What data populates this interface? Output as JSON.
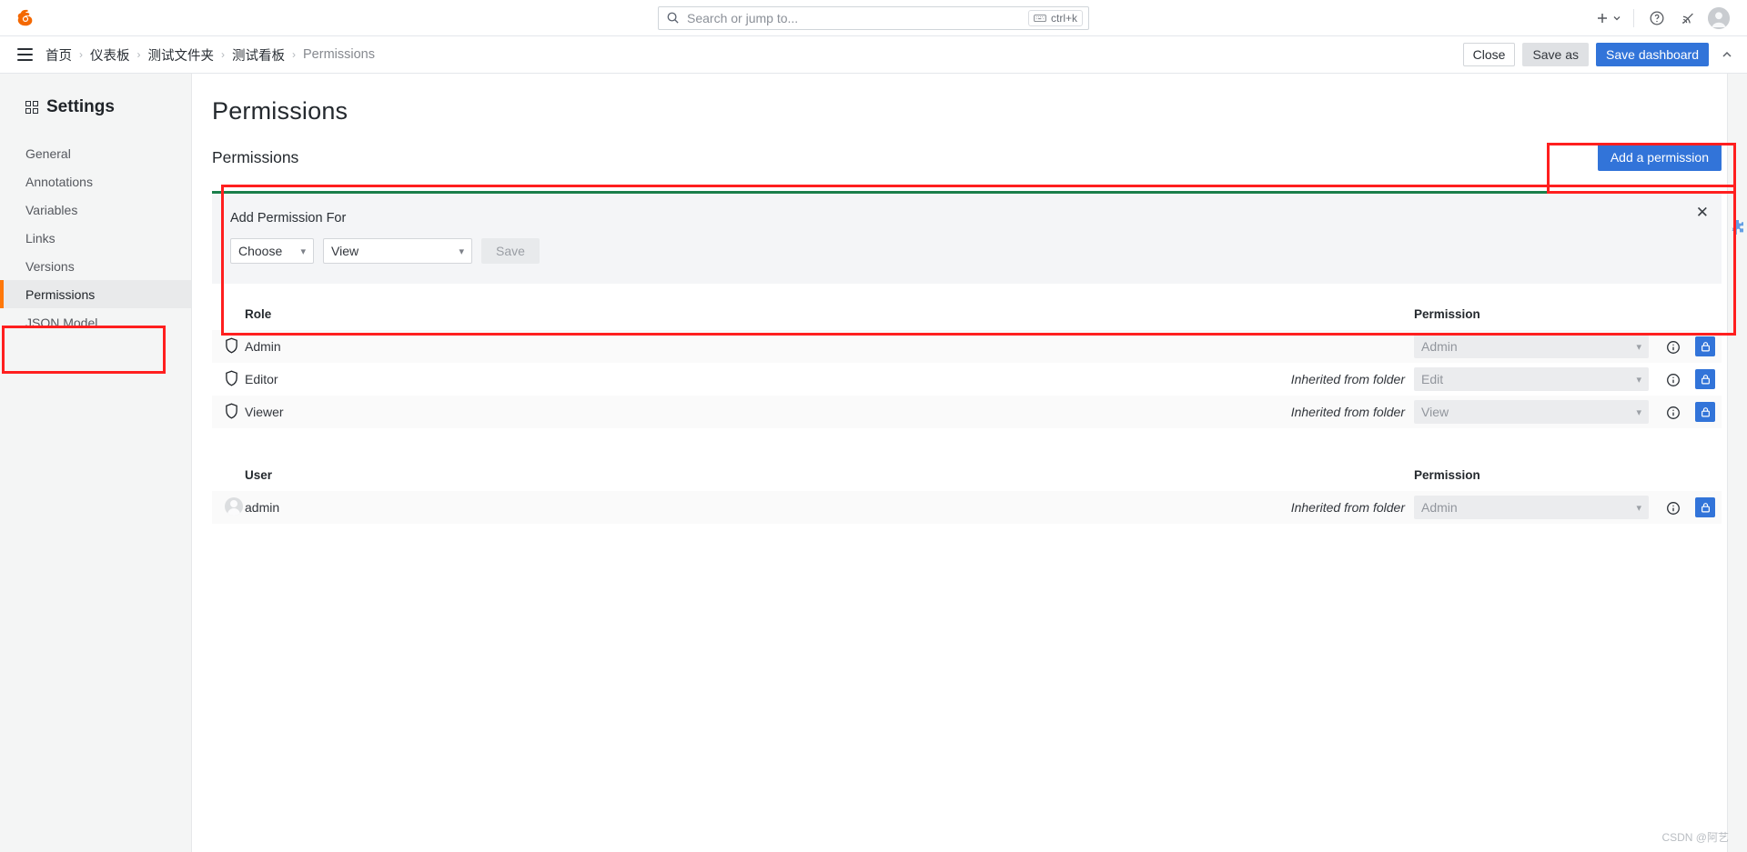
{
  "topbar": {
    "logo_icon": "grafana-logo-icon",
    "search": {
      "placeholder": "Search or jump to...",
      "icon": "search-icon",
      "shortcut": "ctrl+k",
      "shortcut_icon": "keyboard-icon"
    },
    "actions": {
      "plus_icon": "plus-icon",
      "plus_chevron_icon": "chevron-down-icon",
      "help_icon": "help-circle-icon",
      "news_icon": "rss-feed-icon",
      "avatar_icon": "user-avatar-icon"
    }
  },
  "navbar": {
    "menu_icon": "hamburger-menu-icon",
    "breadcrumbs": [
      {
        "label": "首页"
      },
      {
        "label": "仪表板"
      },
      {
        "label": "测试文件夹"
      },
      {
        "label": "测试看板"
      },
      {
        "label": "Permissions"
      }
    ],
    "separator": "›",
    "close_label": "Close",
    "save_as_label": "Save as",
    "save_dashboard_label": "Save dashboard",
    "collapse_icon": "chevron-up-icon"
  },
  "sidebar": {
    "title": "Settings",
    "title_icon": "grid-apps-icon",
    "items": [
      {
        "label": "General",
        "active": false
      },
      {
        "label": "Annotations",
        "active": false
      },
      {
        "label": "Variables",
        "active": false
      },
      {
        "label": "Links",
        "active": false
      },
      {
        "label": "Versions",
        "active": false
      },
      {
        "label": "Permissions",
        "active": true
      },
      {
        "label": "JSON Model",
        "active": false
      }
    ]
  },
  "main": {
    "page_title": "Permissions",
    "section_title": "Permissions",
    "add_permission_button": "Add a permission",
    "add_card": {
      "title": "Add Permission For",
      "close_icon": "close-icon",
      "target_select": {
        "value": "Choose",
        "chevron_icon": "chevron-down-icon"
      },
      "level_select": {
        "value": "View",
        "chevron_icon": "chevron-down-icon"
      },
      "save_label": "Save"
    },
    "role_table": {
      "col_subject": "Role",
      "col_permission": "Permission",
      "rows": [
        {
          "icon": "shield-icon",
          "name": "Admin",
          "inherited": "",
          "permission": "Admin",
          "info_icon": "info-circle-icon",
          "lock_icon": "lock-icon"
        },
        {
          "icon": "shield-icon",
          "name": "Editor",
          "inherited": "Inherited from folder",
          "permission": "Edit",
          "info_icon": "info-circle-icon",
          "lock_icon": "lock-icon"
        },
        {
          "icon": "shield-icon",
          "name": "Viewer",
          "inherited": "Inherited from folder",
          "permission": "View",
          "info_icon": "info-circle-icon",
          "lock_icon": "lock-icon"
        }
      ]
    },
    "user_table": {
      "col_subject": "User",
      "col_permission": "Permission",
      "rows": [
        {
          "icon": "user-avatar-icon",
          "name": "admin",
          "inherited": "Inherited from folder",
          "permission": "Admin",
          "info_icon": "info-circle-icon",
          "lock_icon": "lock-icon"
        }
      ]
    }
  },
  "right_rail": {
    "icon": "puzzle-extension-icon"
  },
  "watermark": "CSDN @阿艺",
  "colors": {
    "primary_blue": "#3274d9",
    "accent_orange": "#ff780a",
    "panel_green": "#1a7f4b",
    "annotation_red": "#ff1f1f"
  }
}
